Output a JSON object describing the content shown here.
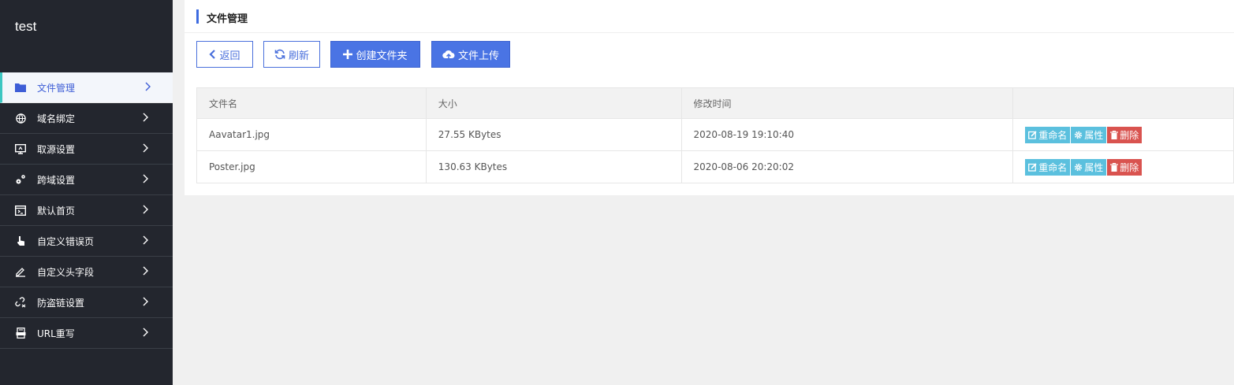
{
  "sidebar": {
    "site_title": "test",
    "items": [
      {
        "label": "文件管理",
        "icon": "folder-icon",
        "active": true
      },
      {
        "label": "域名绑定",
        "icon": "globe-icon"
      },
      {
        "label": "取源设置",
        "icon": "source-icon"
      },
      {
        "label": "跨域设置",
        "icon": "gears-icon"
      },
      {
        "label": "默认首页",
        "icon": "homepage-icon"
      },
      {
        "label": "自定义错误页",
        "icon": "pointer-hand-icon"
      },
      {
        "label": "自定义头字段",
        "icon": "pen-icon"
      },
      {
        "label": "防盗链设置",
        "icon": "broken-link-icon"
      },
      {
        "label": "URL重写",
        "icon": "document-icon"
      }
    ]
  },
  "panel": {
    "title": "文件管理",
    "toolbar": {
      "back_label": "返回",
      "refresh_label": "刷新",
      "create_folder_label": "创建文件夹",
      "upload_label": "文件上传"
    },
    "table": {
      "headers": [
        "文件名",
        "大小",
        "修改时间",
        ""
      ],
      "rows": [
        {
          "name": "Aavatar1.jpg",
          "size": "27.55 KBytes",
          "mtime": "2020-08-19 19:10:40"
        },
        {
          "name": "Poster.jpg",
          "size": "130.63 KBytes",
          "mtime": "2020-08-06 20:20:02"
        }
      ],
      "actions": {
        "rename": "重命名",
        "properties": "属性",
        "delete": "删除"
      }
    }
  },
  "colors": {
    "sidebar_bg": "#23262e",
    "accent": "#4a74e4",
    "action_blue": "#5bc0de",
    "action_red": "#d9534f"
  }
}
